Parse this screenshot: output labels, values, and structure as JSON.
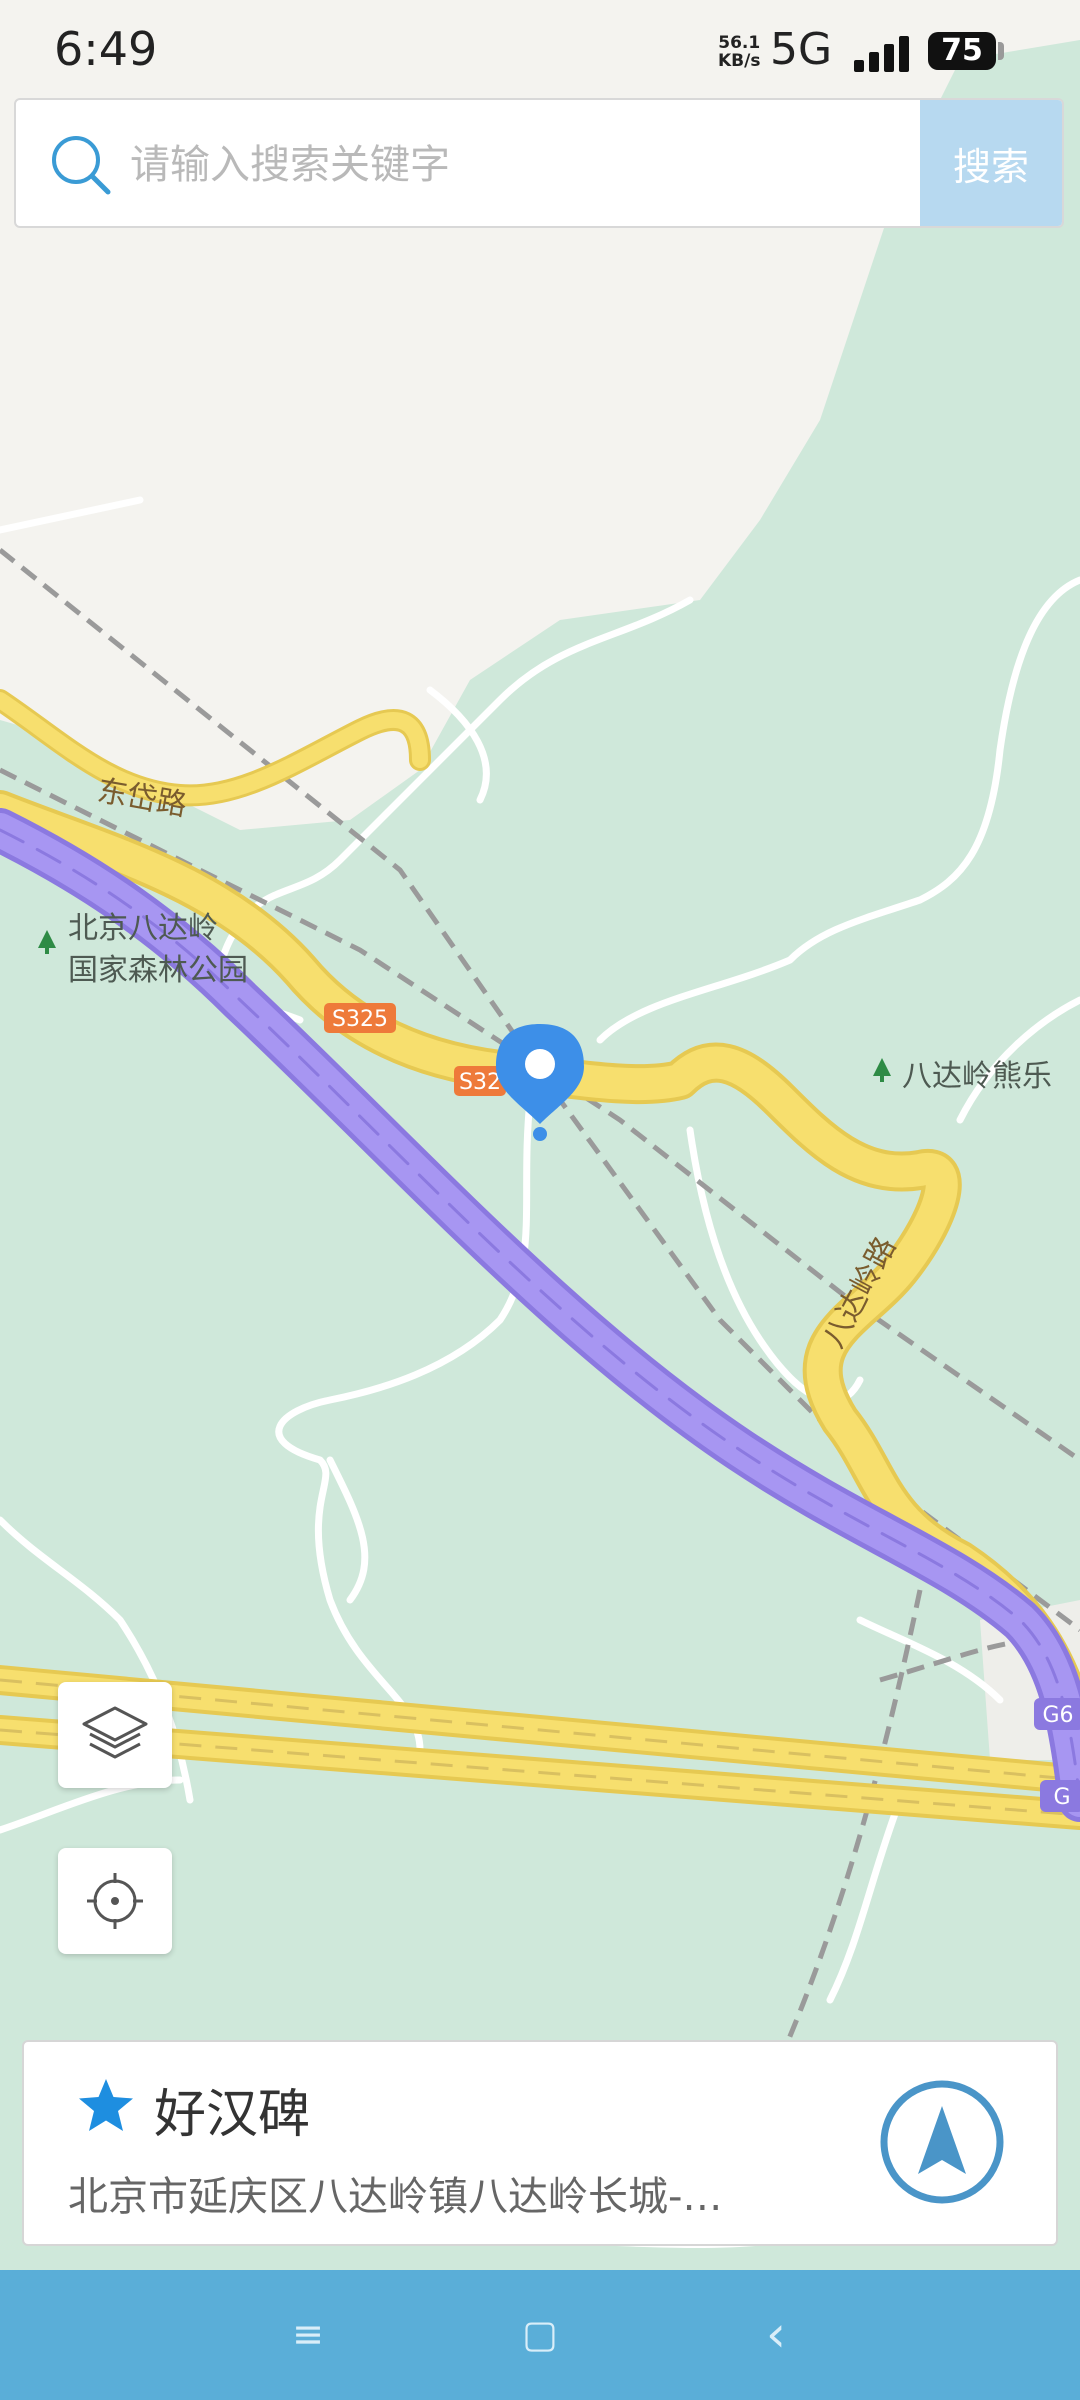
{
  "status_bar": {
    "time": "6:49",
    "net_speed_value": "56.1",
    "net_speed_unit": "KB/s",
    "network": "5G",
    "battery": "75"
  },
  "search": {
    "placeholder": "请输入搜索关键字",
    "button_label": "搜索"
  },
  "map": {
    "road_labels": {
      "dongtai": "东岱路",
      "s325_a": "S325",
      "s325_b": "S32",
      "badaling_road": "八达岭路",
      "g6_a": "G6",
      "g6_b": "G"
    },
    "poi_labels": {
      "forest_park_line1": "北京八达岭",
      "forest_park_line2": "国家森林公园",
      "bear_park": "八达岭熊乐"
    },
    "colors": {
      "land": "#cfe8da",
      "urban": "#f4f3ef",
      "highway": "#9f8ef0",
      "primary_road": "#f7df6e",
      "marker": "#3d8fe8"
    }
  },
  "place_card": {
    "name": "好汉碑",
    "address": "北京市延庆区八达岭镇八达岭长城-…"
  },
  "nav_keys": {
    "menu": "≡",
    "home": "▢",
    "back": "‹"
  }
}
